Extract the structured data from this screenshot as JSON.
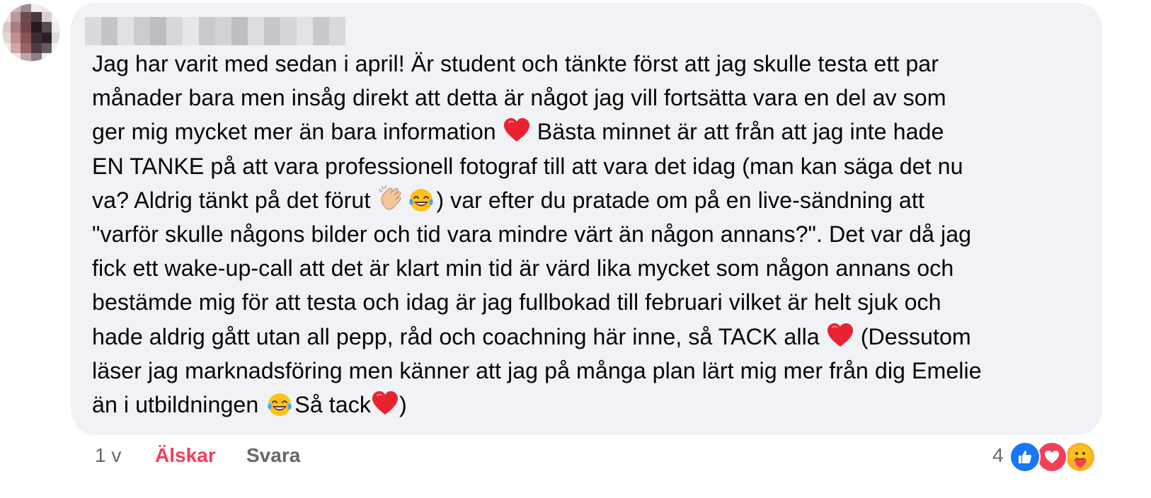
{
  "comment": {
    "lines": [
      "Jag har varit med sedan i april! Är student och tänkte först att jag skulle testa ett par",
      "månader bara men insåg direkt att detta är något jag vill fortsätta vara en del av som",
      "ger mig mycket mer än bara information",
      " Bästa minnet är att från att jag inte hade",
      "EN TANKE på att vara professionell fotograf till att vara det idag (man kan säga det nu",
      "va? Aldrig tänkt på det förut ",
      ") var efter du pratade om på en live-sändning att",
      "\"varför skulle någons bilder och tid vara mindre värt än någon annans?\". Det var då jag",
      "fick ett wake-up-call att det är klart min tid är värd lika mycket som någon annans och",
      "bestämde mig för att testa och idag är jag fullbokad till februari vilket är helt sjuk och",
      "hade aldrig gått utan all pepp, råd och coachning här inne, så TACK alla",
      " (Dessutom",
      "läser jag marknadsföring men känner att jag på många plan lärt mig mer från dig Emelie",
      "än i utbildningen ",
      "Så tack",
      ")"
    ],
    "emojis": {
      "heart": "red-heart-icon",
      "clap": "clapping-hands-icon",
      "laugh": "tears-of-joy-icon"
    }
  },
  "footer": {
    "time": "1 v",
    "love_label": "Älskar",
    "reply_label": "Svara",
    "reaction_count": "4",
    "reactions": [
      "like-icon",
      "love-icon",
      "care-icon"
    ]
  },
  "colors": {
    "bubble": "#f0f2f5",
    "text": "#050505",
    "muted": "#65676b",
    "love": "#f33e58",
    "like": "#1877f2"
  }
}
